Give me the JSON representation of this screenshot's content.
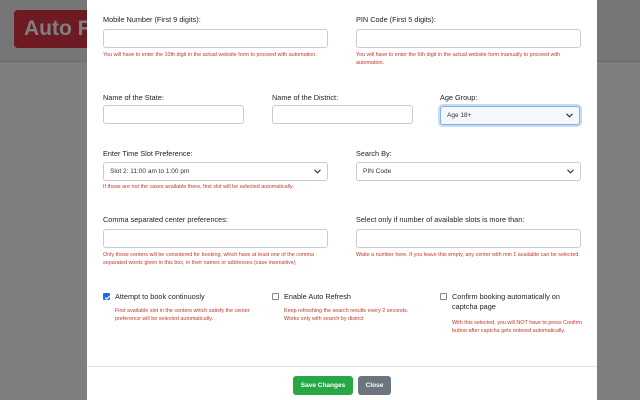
{
  "background": {
    "brand": "Auto Fill"
  },
  "form": {
    "mobile": {
      "label": "Mobile Number (First 9 digits):",
      "value": "",
      "help": "You will have to enter the 10th digit in the actual website form to proceed with automation."
    },
    "pincode": {
      "label": "PIN Code (First 5 digits):",
      "value": "",
      "help": "You will have to enter the 6th digit in the actual website form manually to proceed with automation."
    },
    "state": {
      "label": "Name of the State:",
      "value": ""
    },
    "district": {
      "label": "Name of the District:",
      "value": ""
    },
    "age": {
      "label": "Age Group:",
      "value": "Age 18+"
    },
    "slot": {
      "label": "Enter Time Slot Preference:",
      "value": "Slot 2: 11:00 am to 1:00 pm",
      "help": "If those are not the cases available there, first slot will be selected automatically."
    },
    "search_by": {
      "label": "Search By:",
      "value": "PIN Code"
    },
    "centers": {
      "label": "Comma separated center preferences:",
      "value": "",
      "help": "Only those centers will be considered for booking, which have at least one of the comma separated words given in this box, in their names or addresses (case insensitive)"
    },
    "min_slots": {
      "label": "Select only if number of available slots is more than:",
      "value": "",
      "help": "Waite a number here. If you leave this empty, any center with min 1 available can be selected."
    },
    "book_continuous": {
      "label": "Attempt to book continuosly",
      "checked": true,
      "help": "First available slot in the centers which satisfy the center preference will be selected automatically."
    },
    "auto_refresh": {
      "label": "Enable Auto Refresh",
      "checked": false,
      "help": "Keep refreshing the search results every 2 seconds. Works only with search by district"
    },
    "confirm_auto": {
      "label": "Confirm booking automatically on captcha page",
      "checked": false,
      "help": "With this selected, you will NOT have to press Confirm button after captcha gets entered automatically."
    }
  },
  "buttons": {
    "save": "Save Changes",
    "close": "Close"
  },
  "colors": {
    "save": "#28a745",
    "close": "#6c757d",
    "help_text": "#c0392b",
    "brand": "#dc3545",
    "checkbox_on": "#1a6fe0"
  }
}
